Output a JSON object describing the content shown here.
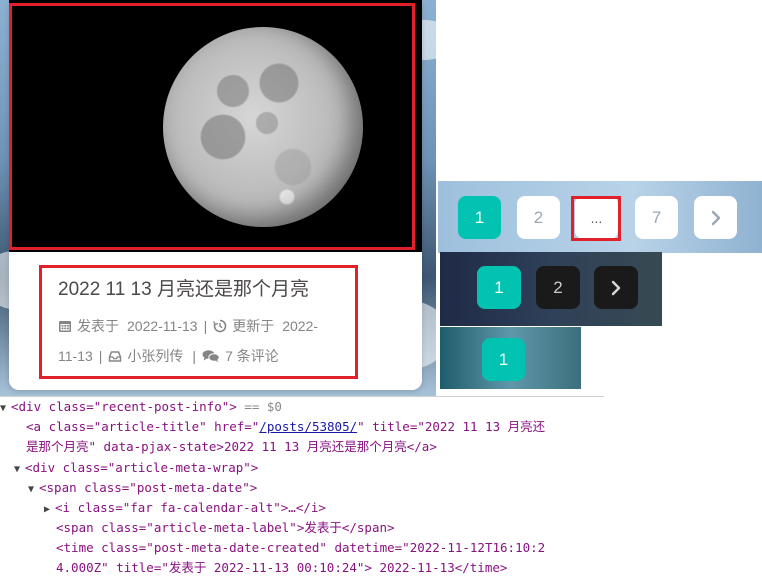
{
  "post": {
    "title": "2022 11 13 月亮还是那个月亮",
    "published_label": "发表于",
    "published_date": "2022-11-13",
    "updated_label": "更新于",
    "updated_date_part1": "2022-",
    "updated_date_part2": "11-13",
    "category": "小张列传",
    "comments": "7 条评论",
    "separator": "|"
  },
  "pagination_light": {
    "pages": [
      "1",
      "2",
      "...",
      "7"
    ],
    "next_icon": "chevron-right-icon"
  },
  "pagination_dark": {
    "pages": [
      "1",
      "2"
    ],
    "next_icon": "chevron-right-icon"
  },
  "pagination_small": {
    "pages": [
      "1"
    ]
  },
  "colors": {
    "accent": "#02c3b1",
    "highlight": "#e0202a",
    "text": "#4c4948",
    "meta": "#858585"
  },
  "devtools": {
    "l1_tag": "<div class=\"recent-post-info\">",
    "l1_suffix": " == $0",
    "l2_open": "<a class=\"article-title\" href=\"",
    "l2_href": "/posts/53805/",
    "l2_rest": "\" title=\"2022 11 13 月亮还",
    "l3": "是那个月亮\" data-pjax-state>2022 11 13 月亮还是那个月亮</a>",
    "l4": "<div class=\"article-meta-wrap\">",
    "l5": "<span class=\"post-meta-date\">",
    "l6": "<i class=\"far fa-calendar-alt\">…</i>",
    "l7": "<span class=\"article-meta-label\">发表于</span>",
    "l8": "<time class=\"post-meta-date-created\" datetime=\"2022-11-12T16:10:2",
    "l9": "4.000Z\" title=\"发表于 2022-11-13 00:10:24\"> 2022-11-13</time>"
  }
}
